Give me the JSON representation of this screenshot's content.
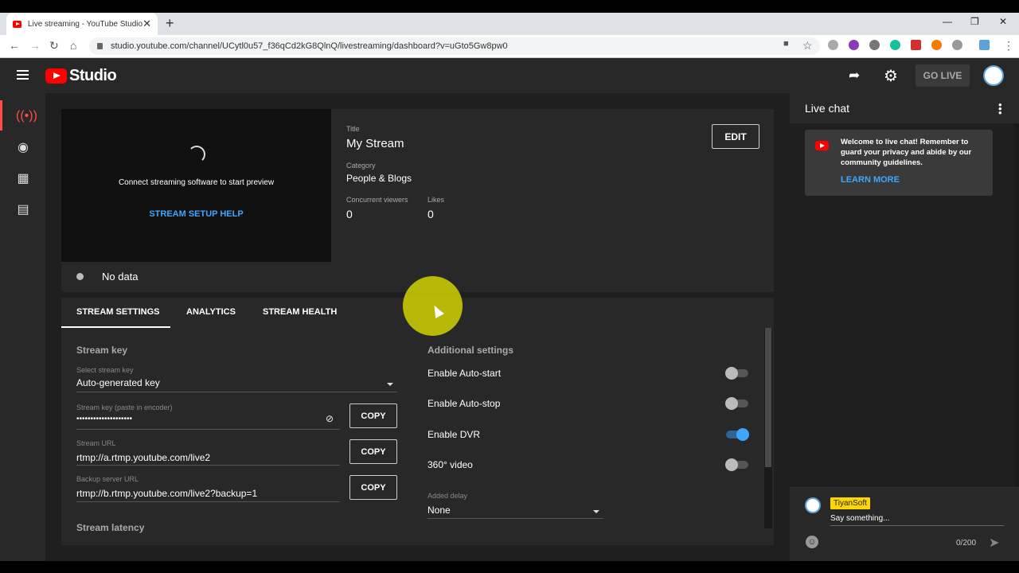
{
  "browser": {
    "tab_title": "Live streaming - YouTube Studio",
    "url": "studio.youtube.com/channel/UCytl0u57_f36qCd2kG8QlnQ/livestreaming/dashboard?v=uGto5Gw8pw0"
  },
  "header": {
    "logo_text": "Studio",
    "go_live_label": "GO LIVE"
  },
  "preview": {
    "message": "Connect streaming software to start preview",
    "setup_help": "STREAM SETUP HELP"
  },
  "stream_info": {
    "title_label": "Title",
    "title_value": "My Stream",
    "category_label": "Category",
    "category_value": "People & Blogs",
    "viewers_label": "Concurrent viewers",
    "viewers_value": "0",
    "likes_label": "Likes",
    "likes_value": "0",
    "edit_label": "EDIT",
    "status_text": "No data"
  },
  "tabs": [
    "STREAM SETTINGS",
    "ANALYTICS",
    "STREAM HEALTH"
  ],
  "stream_key": {
    "section_title": "Stream key",
    "select_label": "Select stream key",
    "select_value": "Auto-generated key",
    "key_label": "Stream key (paste in encoder)",
    "key_value": "••••••••••••••••••••",
    "url_label": "Stream URL",
    "url_value": "rtmp://a.rtmp.youtube.com/live2",
    "backup_label": "Backup server URL",
    "backup_value": "rtmp://b.rtmp.youtube.com/live2?backup=1",
    "copy_label": "COPY",
    "latency_title": "Stream latency"
  },
  "additional": {
    "section_title": "Additional settings",
    "options": [
      {
        "label": "Enable Auto-start",
        "on": false
      },
      {
        "label": "Enable Auto-stop",
        "on": false
      },
      {
        "label": "Enable DVR",
        "on": true
      },
      {
        "label": "360° video",
        "on": false
      }
    ],
    "delay_label": "Added delay",
    "delay_value": "None"
  },
  "chat": {
    "title": "Live chat",
    "welcome": "Welcome to live chat! Remember to guard your privacy and abide by our community guidelines.",
    "learn_more": "LEARN MORE",
    "username": "TiyanSoft",
    "placeholder": "Say something...",
    "counter": "0/200"
  },
  "colors": {
    "accent_blue": "#3ea6ff",
    "youtube_red": "#ff0000",
    "active_nav": "#ff4e45"
  }
}
